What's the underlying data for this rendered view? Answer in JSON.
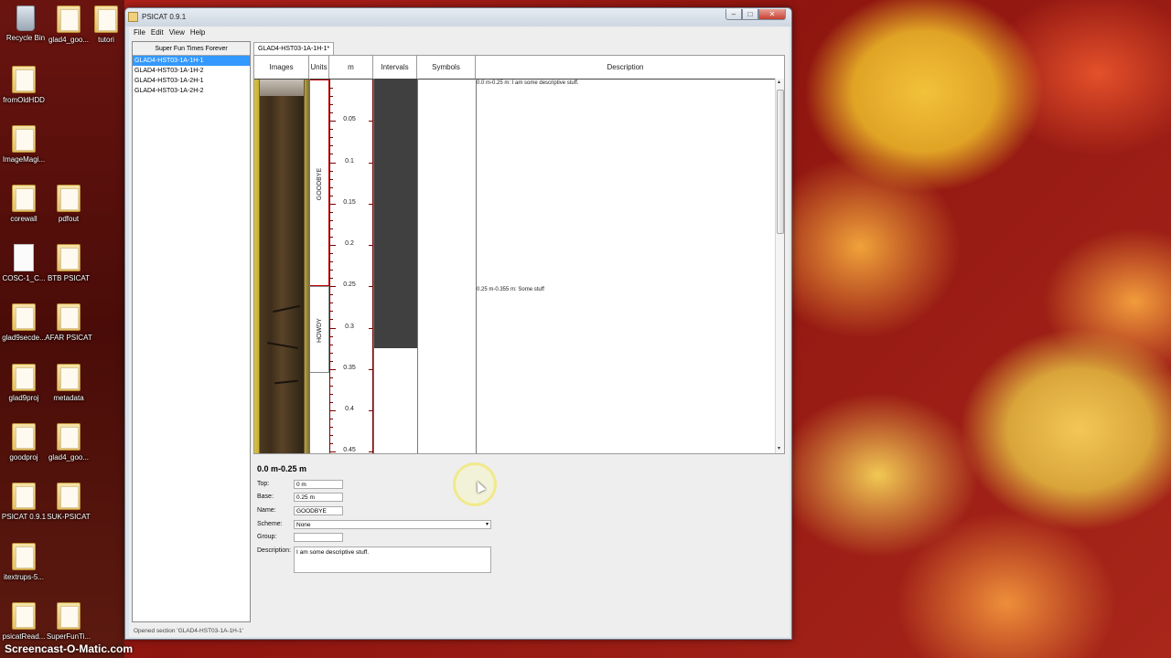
{
  "desktop": {
    "icons": [
      {
        "label": "Recycle Bin",
        "kind": "bin"
      },
      {
        "label": "glad4_goo...",
        "kind": "folder"
      },
      {
        "label": "tutori",
        "kind": "folder"
      },
      {
        "label": "fromOldHDD",
        "kind": "folder"
      },
      {
        "label": "ImageMagi...",
        "kind": "folder"
      },
      {
        "label": "corewall",
        "kind": "folder"
      },
      {
        "label": "pdfout",
        "kind": "folder"
      },
      {
        "label": "COSC-1_C...",
        "kind": "file"
      },
      {
        "label": "BTB PSICAT",
        "kind": "folder"
      },
      {
        "label": "glad9secde...",
        "kind": "folder"
      },
      {
        "label": "AFAR PSICAT",
        "kind": "folder"
      },
      {
        "label": "glad9proj",
        "kind": "folder"
      },
      {
        "label": "metadata",
        "kind": "folder"
      },
      {
        "label": "goodproj",
        "kind": "folder"
      },
      {
        "label": "glad4_goo...",
        "kind": "folder"
      },
      {
        "label": "PSICAT 0.9.1",
        "kind": "folder"
      },
      {
        "label": "SUK-PSICAT",
        "kind": "folder"
      },
      {
        "label": "itextrups-5...",
        "kind": "folder"
      },
      {
        "label": "psicatRead...",
        "kind": "folder"
      },
      {
        "label": "SuperFunTi...",
        "kind": "folder"
      }
    ],
    "watermark": "Screencast-O-Matic.com"
  },
  "window": {
    "title": "PSICAT 0.9.1",
    "controls": {
      "minimize": "–",
      "maximize": "□",
      "close": "✕"
    }
  },
  "menu": [
    "File",
    "Edit",
    "View",
    "Help"
  ],
  "project": {
    "title": "Super Fun Times Forever",
    "sections": [
      {
        "label": "GLAD4-HST03-1A-1H-1",
        "selected": true
      },
      {
        "label": "GLAD4-HST03-1A-1H-2",
        "selected": false
      },
      {
        "label": "GLAD4-HST03-1A-2H-1",
        "selected": false
      },
      {
        "label": "GLAD4-HST03-1A-2H-2",
        "selected": false
      }
    ]
  },
  "status": "Opened section 'GLAD4-HST03-1A-1H-1'",
  "editor": {
    "tab_label": "GLAD4-HST03-1A-1H-1*",
    "columns": {
      "images": "Images",
      "units": "Units",
      "m": "m",
      "intervals": "Intervals",
      "symbols": "Symbols",
      "description": "Description"
    },
    "depth_ticks": [
      "0.05",
      "0.1",
      "0.15",
      "0.2",
      "0.25",
      "0.3",
      "0.35",
      "0.4",
      "0.45"
    ],
    "units": [
      {
        "name": "GOODBYE",
        "top_m": 0.0,
        "base_m": 0.25
      },
      {
        "name": "HOWDY",
        "top_m": 0.25,
        "base_m": 0.355
      }
    ],
    "interval": {
      "top_m": 0.0,
      "base_m": 0.325
    },
    "descriptions": [
      {
        "top_m": 0.0,
        "text": "0.0 m-0.25 m: I am some descriptive stuff."
      },
      {
        "top_m": 0.25,
        "text": "0.25 m-0.355 m: Some stuff"
      }
    ]
  },
  "properties": {
    "heading": "0.0 m-0.25 m",
    "top_label": "Top:",
    "top_value": "0 m",
    "base_label": "Base:",
    "base_value": "0.25 m",
    "name_label": "Name:",
    "name_value": "GOODBYE",
    "scheme_label": "Scheme:",
    "scheme_value": "None",
    "group_label": "Group:",
    "group_value": "",
    "description_label": "Description:",
    "description_value": "I am some descriptive stuff."
  },
  "icons": {
    "dropdown": "▾",
    "scroll_up": "▴",
    "scroll_down": "▾"
  }
}
